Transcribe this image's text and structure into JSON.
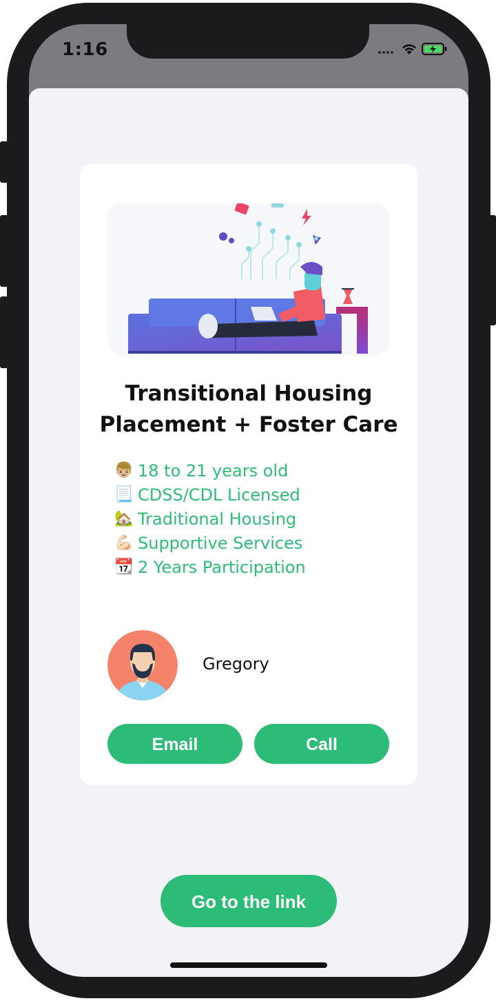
{
  "status_bar": {
    "time": "1:16",
    "icons": [
      "signal-icon",
      "wifi-icon",
      "battery-charging-icon"
    ]
  },
  "card": {
    "title_line1": "Transitional Housing",
    "title_line2": "Placement + Foster Care",
    "features": [
      {
        "emoji": "👦🏼",
        "icon": "boy-icon",
        "label": "18 to 21 years old"
      },
      {
        "emoji": "📃",
        "icon": "document-icon",
        "label": "CDSS/CDL Licensed"
      },
      {
        "emoji": "🏡",
        "icon": "house-icon",
        "label": "Traditional Housing"
      },
      {
        "emoji": "💪🏻",
        "icon": "flexed-biceps-icon",
        "label": "Supportive Services"
      },
      {
        "emoji": "📆",
        "icon": "calendar-icon",
        "label": "2 Years Participation"
      }
    ],
    "contact": {
      "name": "Gregory"
    },
    "email_label": "Email",
    "call_label": "Call"
  },
  "link_label": "Go to the link",
  "colors": {
    "accent": "#2dbc77",
    "sheet_background": "#f2f2f7",
    "card_background": "#ffffff",
    "avatar_background": "#f4836a"
  }
}
